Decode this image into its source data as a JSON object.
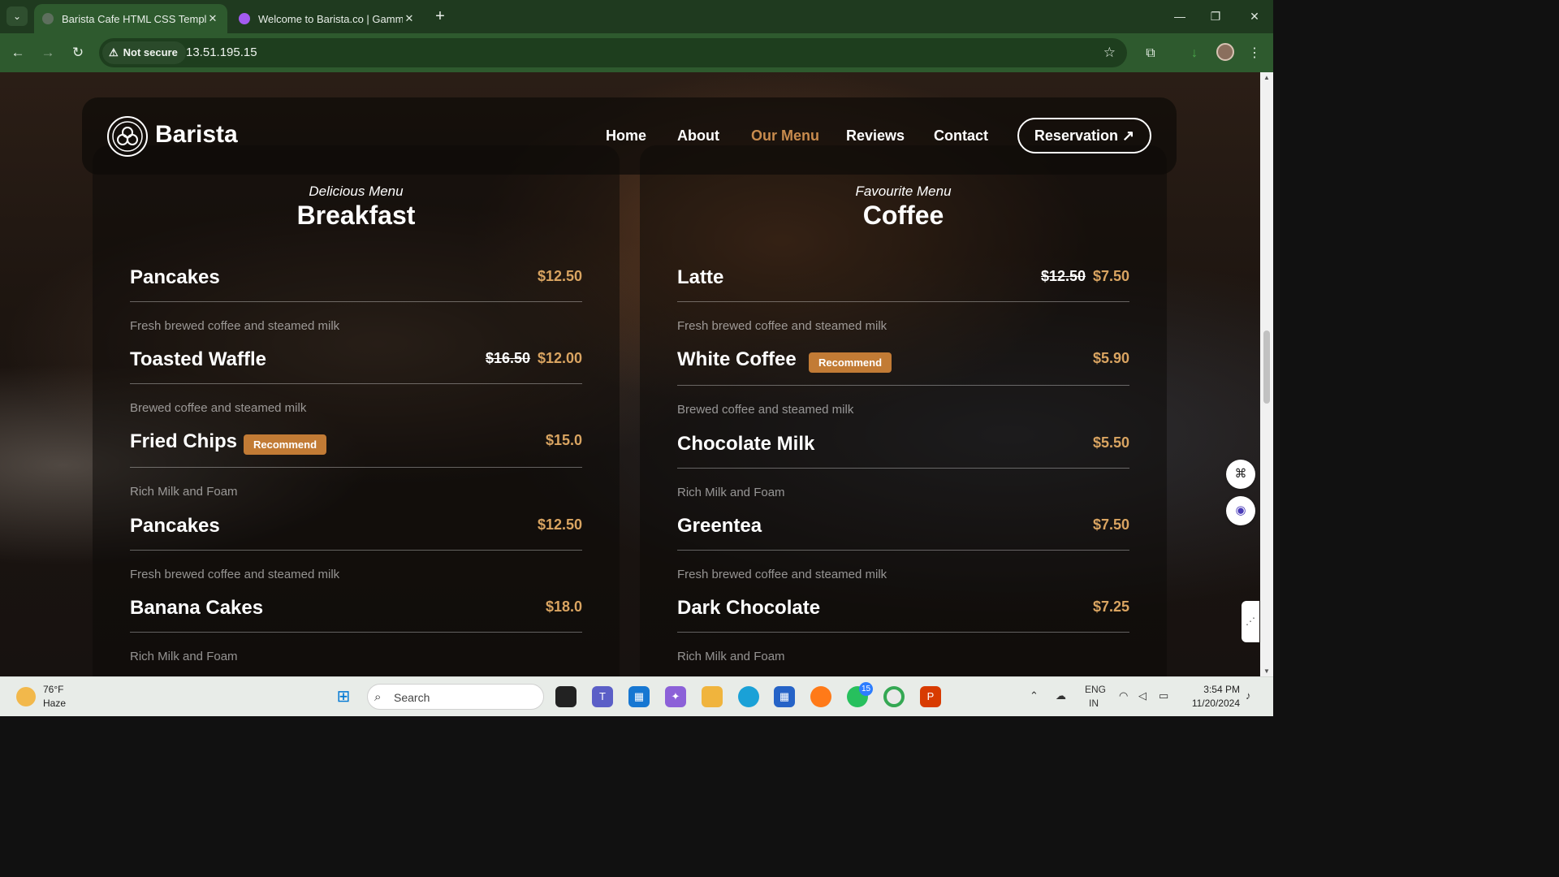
{
  "browser": {
    "tabs": [
      {
        "title": "Barista Cafe HTML CSS Template",
        "active": true
      },
      {
        "title": "Welcome to Barista.co | Gamma",
        "active": false
      }
    ],
    "new_tab": "+",
    "close_glyph": "✕",
    "security": "Not secure",
    "url": "13.51.195.15",
    "window_controls": [
      "—",
      "❐",
      "✕"
    ]
  },
  "site": {
    "brand": "Barista",
    "nav": [
      "Home",
      "About",
      "Our Menu",
      "Reviews",
      "Contact"
    ],
    "active_nav": "Our Menu",
    "reservation": "Reservation ↗",
    "sections": [
      {
        "subtitle": "Delicious Menu",
        "title": "Breakfast",
        "items": [
          {
            "name": "Pancakes",
            "price": "$12.50",
            "old_price": "",
            "badge": "",
            "desc": "Fresh brewed coffee and steamed milk"
          },
          {
            "name": "Toasted Waffle",
            "price": "$12.00",
            "old_price": "$16.50",
            "badge": "",
            "desc": "Brewed coffee and steamed milk"
          },
          {
            "name": "Fried Chips",
            "price": "$15.0",
            "old_price": "",
            "badge": "Recommend",
            "desc": "Rich Milk and Foam"
          },
          {
            "name": "Pancakes",
            "price": "$12.50",
            "old_price": "",
            "badge": "",
            "desc": "Fresh brewed coffee and steamed milk"
          },
          {
            "name": "Banana Cakes",
            "price": "$18.0",
            "old_price": "",
            "badge": "",
            "desc": "Rich Milk and Foam"
          }
        ]
      },
      {
        "subtitle": "Favourite Menu",
        "title": "Coffee",
        "items": [
          {
            "name": "Latte",
            "price": "$7.50",
            "old_price": "$12.50",
            "badge": "",
            "desc": "Fresh brewed coffee and steamed milk"
          },
          {
            "name": "White Coffee",
            "price": "$5.90",
            "old_price": "",
            "badge": "Recommend",
            "desc": "Brewed coffee and steamed milk"
          },
          {
            "name": "Chocolate Milk",
            "price": "$5.50",
            "old_price": "",
            "badge": "",
            "desc": "Rich Milk and Foam"
          },
          {
            "name": "Greentea",
            "price": "$7.50",
            "old_price": "",
            "badge": "",
            "desc": "Fresh brewed coffee and steamed milk"
          },
          {
            "name": "Dark Chocolate",
            "price": "$7.25",
            "old_price": "",
            "badge": "",
            "desc": "Rich Milk and Foam"
          }
        ]
      }
    ]
  },
  "taskbar": {
    "weather": {
      "temp": "76°F",
      "condition": "Haze"
    },
    "search": "Search",
    "whatsapp_badge": "15",
    "language": [
      "ENG",
      "IN"
    ],
    "time": "3:54 PM",
    "date": "11/20/2024"
  },
  "colors": {
    "browser_frame": "#1f3a1f",
    "browser_toolbar": "#2e5a2e",
    "accent_price": "#d9a461",
    "active_nav": "#c88b4d",
    "badge": "#c27b35"
  }
}
